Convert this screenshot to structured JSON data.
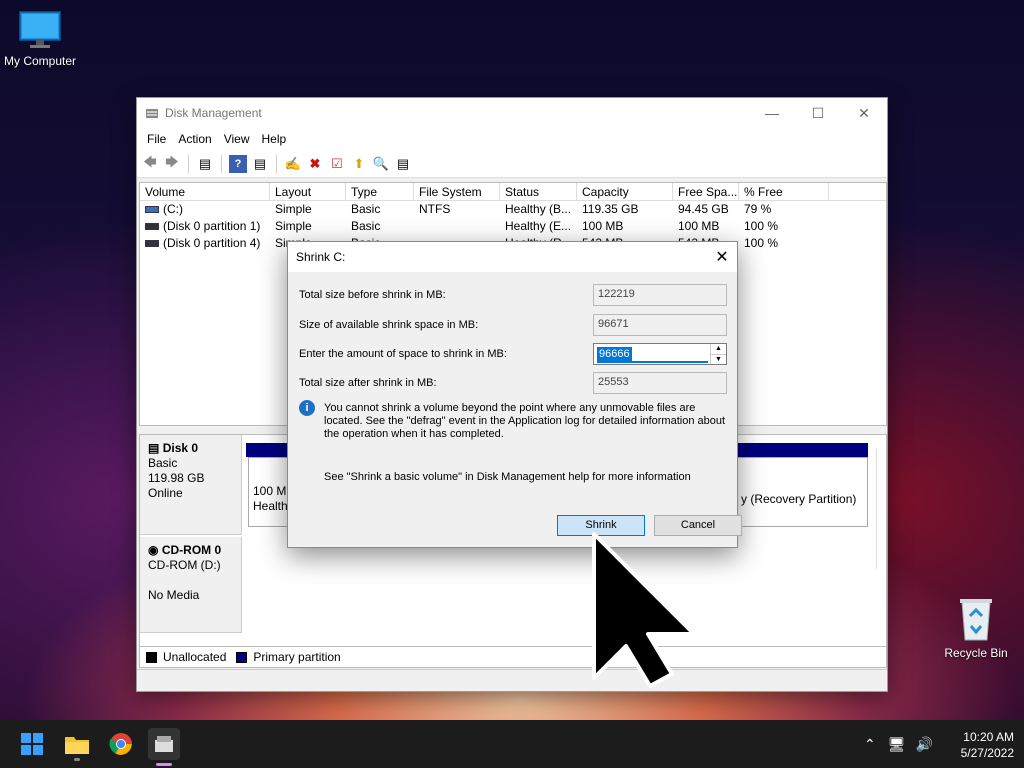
{
  "desktop": {
    "my_computer": "My Computer",
    "recycle_bin": "Recycle Bin"
  },
  "window": {
    "title": "Disk Management",
    "menu": [
      "File",
      "Action",
      "View",
      "Help"
    ],
    "volume_columns": [
      "Volume",
      "Layout",
      "Type",
      "File System",
      "Status",
      "Capacity",
      "Free Spa...",
      "% Free"
    ],
    "volumes": [
      {
        "volume": "(C:)",
        "layout": "Simple",
        "type": "Basic",
        "fs": "NTFS",
        "status": "Healthy (B...",
        "capacity": "119.35 GB",
        "free": "94.45 GB",
        "pct": "79 %"
      },
      {
        "volume": "(Disk 0 partition 1)",
        "layout": "Simple",
        "type": "Basic",
        "fs": "",
        "status": "Healthy (E...",
        "capacity": "100 MB",
        "free": "100 MB",
        "pct": "100 %"
      },
      {
        "volume": "(Disk 0 partition 4)",
        "layout": "Simple",
        "type": "Basic",
        "fs": "",
        "status": "Healthy (R...",
        "capacity": "543 MB",
        "free": "543 MB",
        "pct": "100 %"
      }
    ],
    "disk0": {
      "name": "Disk 0",
      "type": "Basic",
      "size": "119.98 GB",
      "state": "Online",
      "part1_size": "100 MB",
      "part1_status": "Healthy",
      "part3_status": "y (Recovery Partition)"
    },
    "cdrom": {
      "name": "CD-ROM 0",
      "drive": "CD-ROM (D:)",
      "media": "No Media"
    },
    "legend": {
      "unallocated": "Unallocated",
      "primary": "Primary partition",
      "unallocated_color": "#000000",
      "primary_color": "#00007e"
    }
  },
  "dialog": {
    "title": "Shrink C:",
    "total_before_label": "Total size before shrink in MB:",
    "total_before_value": "122219",
    "available_label": "Size of available shrink space in MB:",
    "available_value": "96671",
    "amount_label": "Enter the amount of space to shrink in MB:",
    "amount_value": "96666",
    "total_after_label": "Total size after shrink in MB:",
    "total_after_value": "25553",
    "info_text": "You cannot shrink a volume beyond the point where any unmovable files are located. See the \"defrag\" event in the Application log for detailed information about the operation when it has completed.",
    "help_text": "See \"Shrink a basic volume\" in Disk Management help for more information",
    "shrink_button": "Shrink",
    "cancel_button": "Cancel"
  },
  "taskbar": {
    "time": "10:20 AM",
    "date": "5/27/2022"
  }
}
